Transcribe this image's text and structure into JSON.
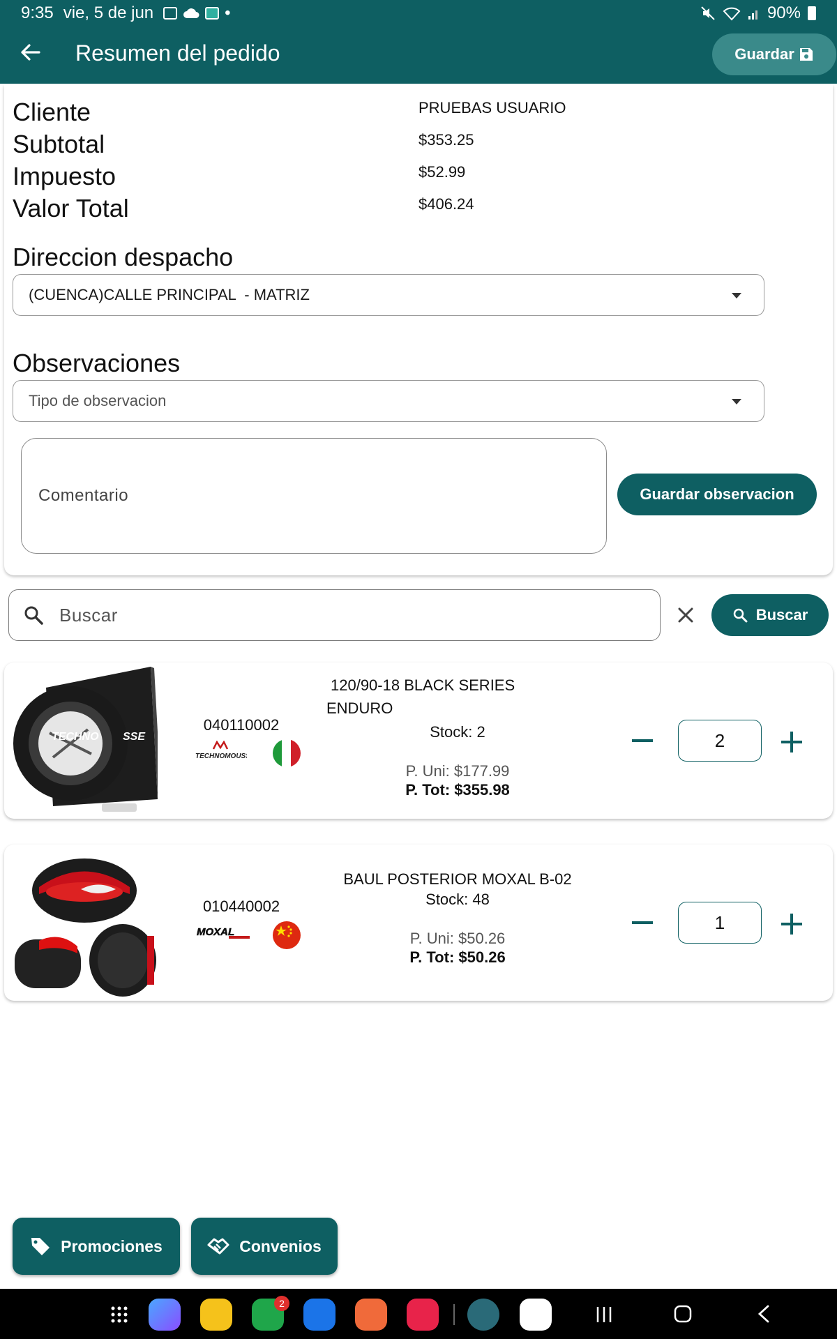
{
  "status_bar": {
    "time": "9:35",
    "date": "vie, 5 de jun",
    "battery": "90%"
  },
  "header": {
    "title": "Resumen del pedido",
    "save_label": "Guardar",
    "back_icon": "arrow-left-icon"
  },
  "summary": {
    "cliente_label": "Cliente",
    "cliente_value": "PRUEBAS USUARIO",
    "subtotal_label": "Subtotal",
    "subtotal_value": "$353.25",
    "impuesto_label": "Impuesto",
    "impuesto_value": "$52.99",
    "total_label": "Valor Total",
    "total_value": "$406.24"
  },
  "dispatch": {
    "label": "Direccion despacho",
    "selected": "(CUENCA)CALLE PRINCIPAL  - MATRIZ"
  },
  "observations": {
    "label": "Observaciones",
    "type_placeholder": "Tipo de observacion",
    "comment_placeholder": "Comentario",
    "save_button": "Guardar observacion"
  },
  "search": {
    "placeholder": "Buscar",
    "button": "Buscar"
  },
  "products": [
    {
      "code": "040110002",
      "name_line1": "120/90-18 BLACK SERIES",
      "name_line2": "ENDURO",
      "stock": "Stock: 2",
      "unit_price": "P. Uni: $177.99",
      "total_price": "P. Tot: $355.98",
      "quantity": "2",
      "brand": "TECHNOMOUSSE",
      "origin": "Italy"
    },
    {
      "code": "010440002",
      "name_line1": "BAUL POSTERIOR MOXAL B-02",
      "stock": "Stock: 48",
      "unit_price": "P. Uni: $50.26",
      "total_price": "P. Tot: $50.26",
      "quantity": "1",
      "brand": "MOXAL",
      "origin": "China"
    }
  ],
  "fab_buttons": {
    "promociones": "Promociones",
    "convenios": "Convenios"
  },
  "navbar": {
    "phone_badge": "2"
  },
  "colors": {
    "primary": "#0e5f62",
    "header_button": "#3a8a8a"
  }
}
